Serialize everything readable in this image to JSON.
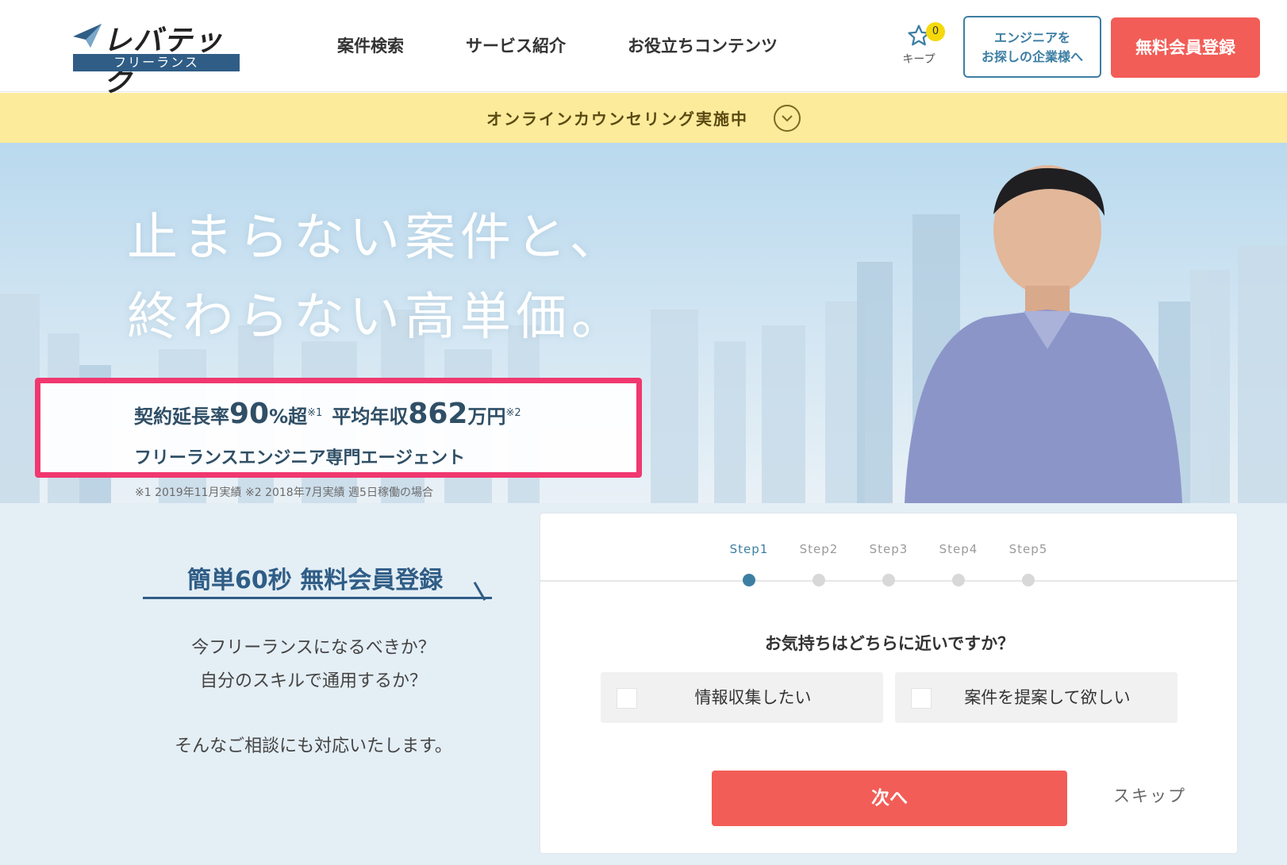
{
  "header": {
    "logo_main": "レバテック",
    "logo_sub": "フリーランス",
    "nav": [
      "案件検索",
      "サービス紹介",
      "お役立ちコンテンツ"
    ],
    "keep_label": "キープ",
    "keep_count": "0",
    "corp_button_line1": "エンジニアを",
    "corp_button_line2": "お探しの企業様へ",
    "register_button": "無料会員登録"
  },
  "counsel_bar": {
    "text": "オンラインカウンセリング実施中"
  },
  "hero": {
    "title_line1": "止まらない案件と、",
    "title_line2": "終わらない高単価。",
    "stat1_label": "契約延長率",
    "stat1_value": "90",
    "stat1_unit": "%超",
    "stat1_note": "※1",
    "stat2_label": "平均年収",
    "stat2_value": "862",
    "stat2_unit": "万円",
    "stat2_note": "※2",
    "subline": "フリーランスエンジニア専門エージェント",
    "footnote": "※1 2019年11月実績 ※2 2018年7月実績 週5日稼働の場合"
  },
  "signup": {
    "title": "簡単60秒 無料会員登録",
    "copy_line1": "今フリーランスになるべきか？",
    "copy_line2": "自分のスキルで通用するか？",
    "copy_line3": "そんなご相談にも対応いたします。"
  },
  "form": {
    "steps": [
      "Step1",
      "Step2",
      "Step3",
      "Step4",
      "Step5"
    ],
    "active_step": 1,
    "question": "お気持ちはどちらに近いですか？",
    "options": [
      "情報収集したい",
      "案件を提案して欲しい"
    ],
    "next_button": "次へ",
    "skip": "スキップ"
  },
  "colors": {
    "accent_red": "#f25d57",
    "brand_blue": "#2f5d86",
    "highlight_pink": "#f0386f",
    "banner_yellow": "#fbeb9b"
  }
}
